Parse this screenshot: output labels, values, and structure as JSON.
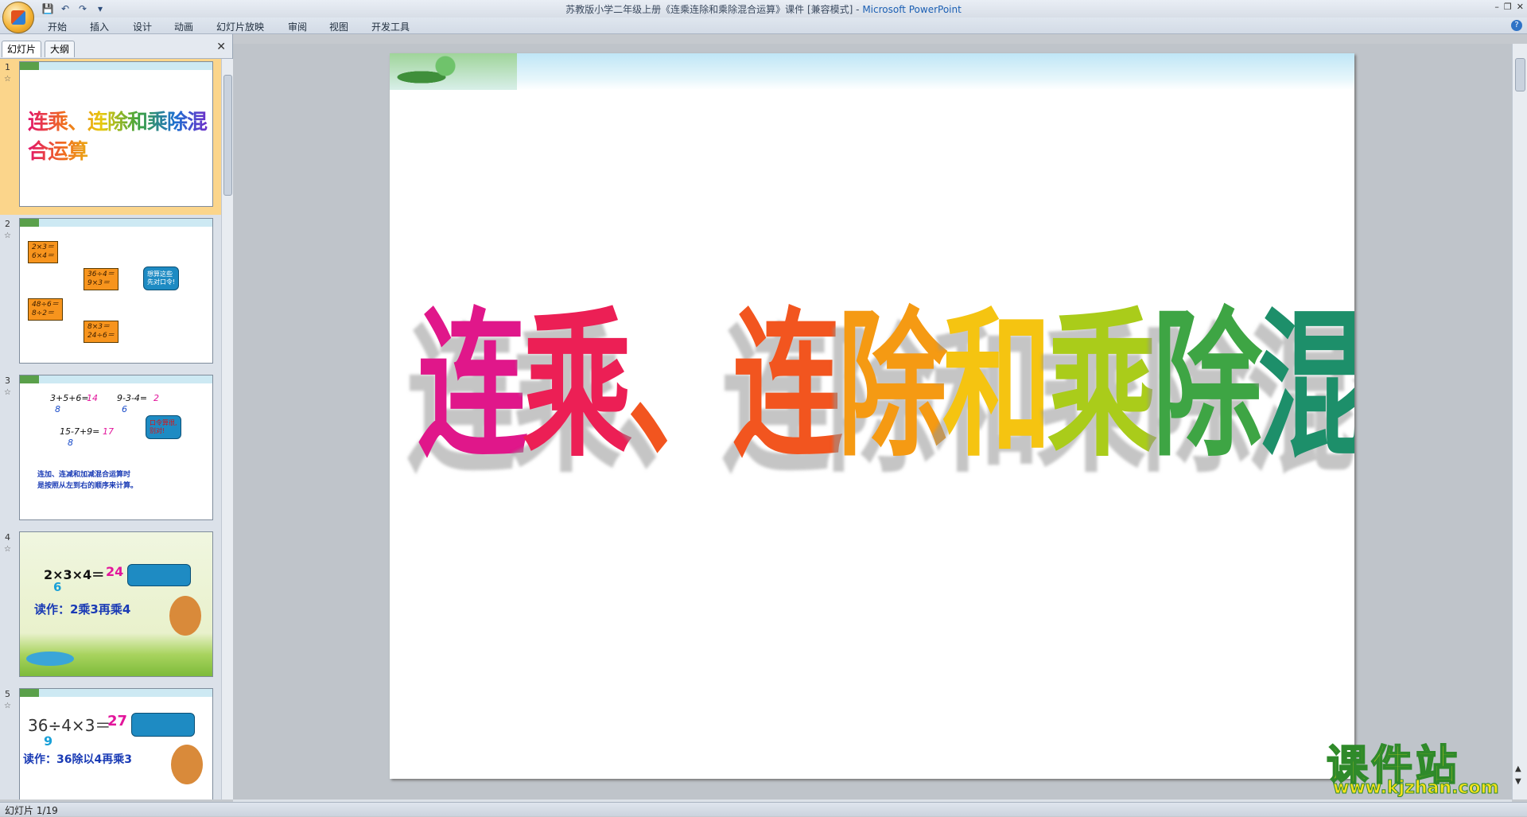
{
  "window": {
    "title": "苏教版小学二年级上册《连乘连除和乘除混合运算》课件 [兼容模式] - ",
    "app_name": "Microsoft PowerPoint"
  },
  "ribbon_tabs": [
    "开始",
    "插入",
    "设计",
    "动画",
    "幻灯片放映",
    "审阅",
    "视图",
    "开发工具"
  ],
  "panel_tabs": {
    "slides": "幻灯片",
    "outline": "大纲"
  },
  "slides": [
    {
      "num": "1",
      "title": "连乘、连除和乘除混合运算"
    },
    {
      "num": "2",
      "boxes": [
        "2×3＝\n6×4＝",
        "36÷4＝\n9×3＝",
        "48÷6＝\n8÷2＝",
        "8×3＝\n24÷6＝"
      ],
      "bubble": "想算这些\n先对口令!"
    },
    {
      "num": "3",
      "lines": [
        "3+5+6=",
        "14",
        "8",
        "9-3-4=",
        "2",
        "6",
        "15-7+9=",
        "17",
        "8"
      ],
      "note": "连加、连减和加减混合运算时\n是按照从左到右的顺序来计算。",
      "bubble": "口令算很,\n别对!"
    },
    {
      "num": "4",
      "expr": "2×3×4＝",
      "result": "24",
      "partial": "6",
      "read": "读作：2乘3再乘4"
    },
    {
      "num": "5",
      "expr": "36÷4×3＝",
      "result": "27",
      "partial": "9",
      "read": "读作：36除以4再乘3"
    }
  ],
  "main_slide_title": "连乘、连除和乘除混合运算",
  "status": "幻灯片 1/19",
  "watermark": {
    "text": "课件站",
    "url": "www.kjzhan.com"
  }
}
